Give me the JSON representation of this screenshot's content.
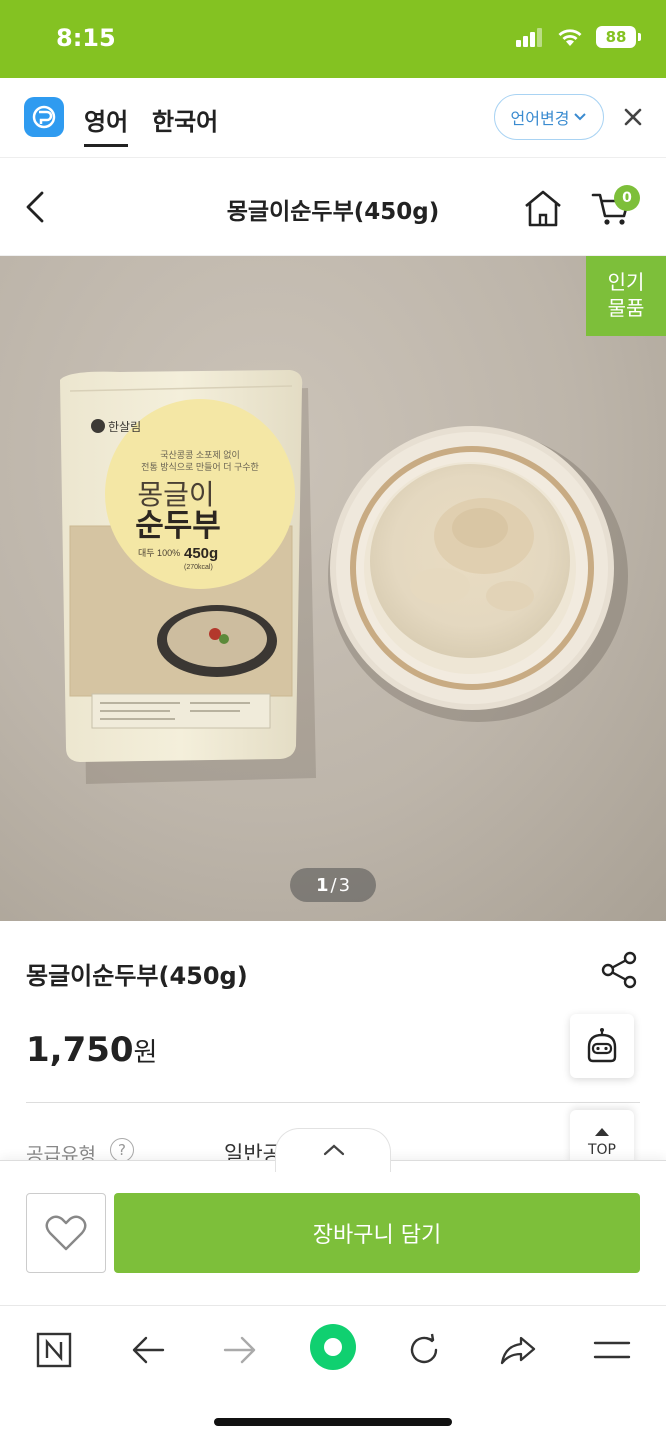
{
  "status_bar": {
    "time": "8:15",
    "battery": "88"
  },
  "translate_bar": {
    "tabs": [
      {
        "label": "영어",
        "active": true
      },
      {
        "label": "한국어",
        "active": false
      }
    ],
    "change_language_label": "언어변경"
  },
  "header": {
    "title": "몽글이순두부(450g)",
    "cart_count": "0"
  },
  "hero": {
    "badge": {
      "line1": "인기",
      "line2": "물품"
    },
    "page_current": "1",
    "page_separator": "/",
    "page_total": "3",
    "package": {
      "brand": "한살림",
      "tagline1": "국산콩콩 소포제 없이",
      "tagline2": "전통 방식으로 만들어 더 구수한",
      "name_line1": "몽글이",
      "name_line2": "순두부",
      "soy_note": "대두 100%",
      "weight": "450g",
      "kcal": "(270kcal)"
    }
  },
  "product": {
    "name": "몽글이순두부(450g)",
    "price": "1,750",
    "price_unit": "원",
    "supply_type_label": "공급유형",
    "supply_type_value": "일반공"
  },
  "floating": {
    "top_label": "TOP"
  },
  "purchase": {
    "add_to_cart_label": "장바구니 담기"
  },
  "colors": {
    "brand_green": "#7dbf3a",
    "status_green": "#84c222",
    "accent_blue": "#2f9bf0"
  }
}
